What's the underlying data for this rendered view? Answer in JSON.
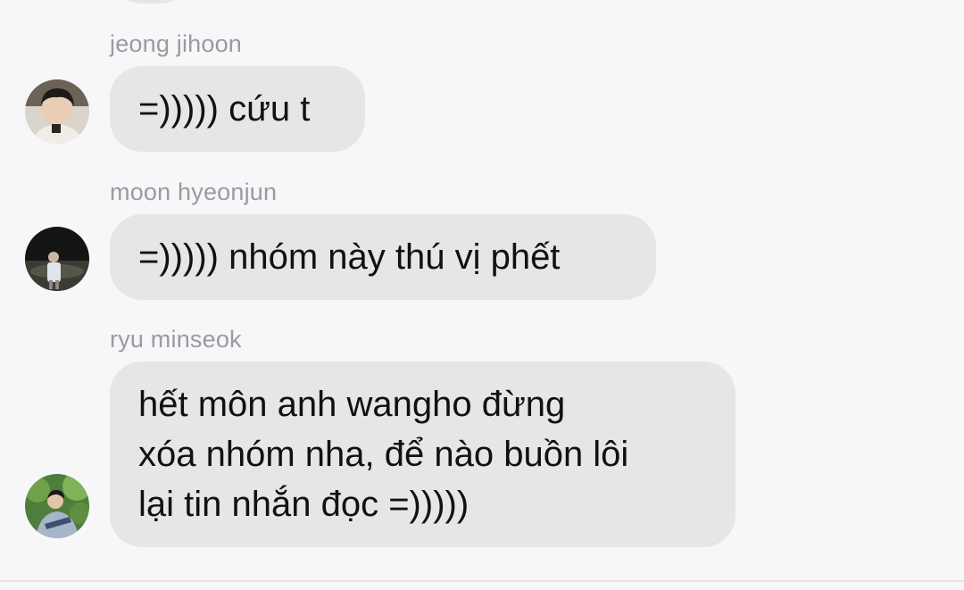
{
  "chat": {
    "messages": [
      {
        "sender": "jeong jihoon",
        "lines": [
          "=))))) cứu t"
        ]
      },
      {
        "sender": "moon hyeonjun",
        "lines": [
          "=))))) nhóm này thú vị phết"
        ]
      },
      {
        "sender": "ryu minseok",
        "lines": [
          "hết môn anh wangho đừng",
          "xóa nhóm nha, để nào buồn lôi",
          "lại tin nhắn đọc =)))))"
        ]
      }
    ]
  },
  "colors": {
    "background": "#f7f7f9",
    "bubble": "#e6e6e8",
    "sender_name": "#9a9a9f",
    "message_text": "#111111"
  },
  "icons": {
    "avatar_1": "avatar-photo-icon",
    "avatar_2": "avatar-photo-icon",
    "avatar_3": "avatar-photo-icon"
  }
}
